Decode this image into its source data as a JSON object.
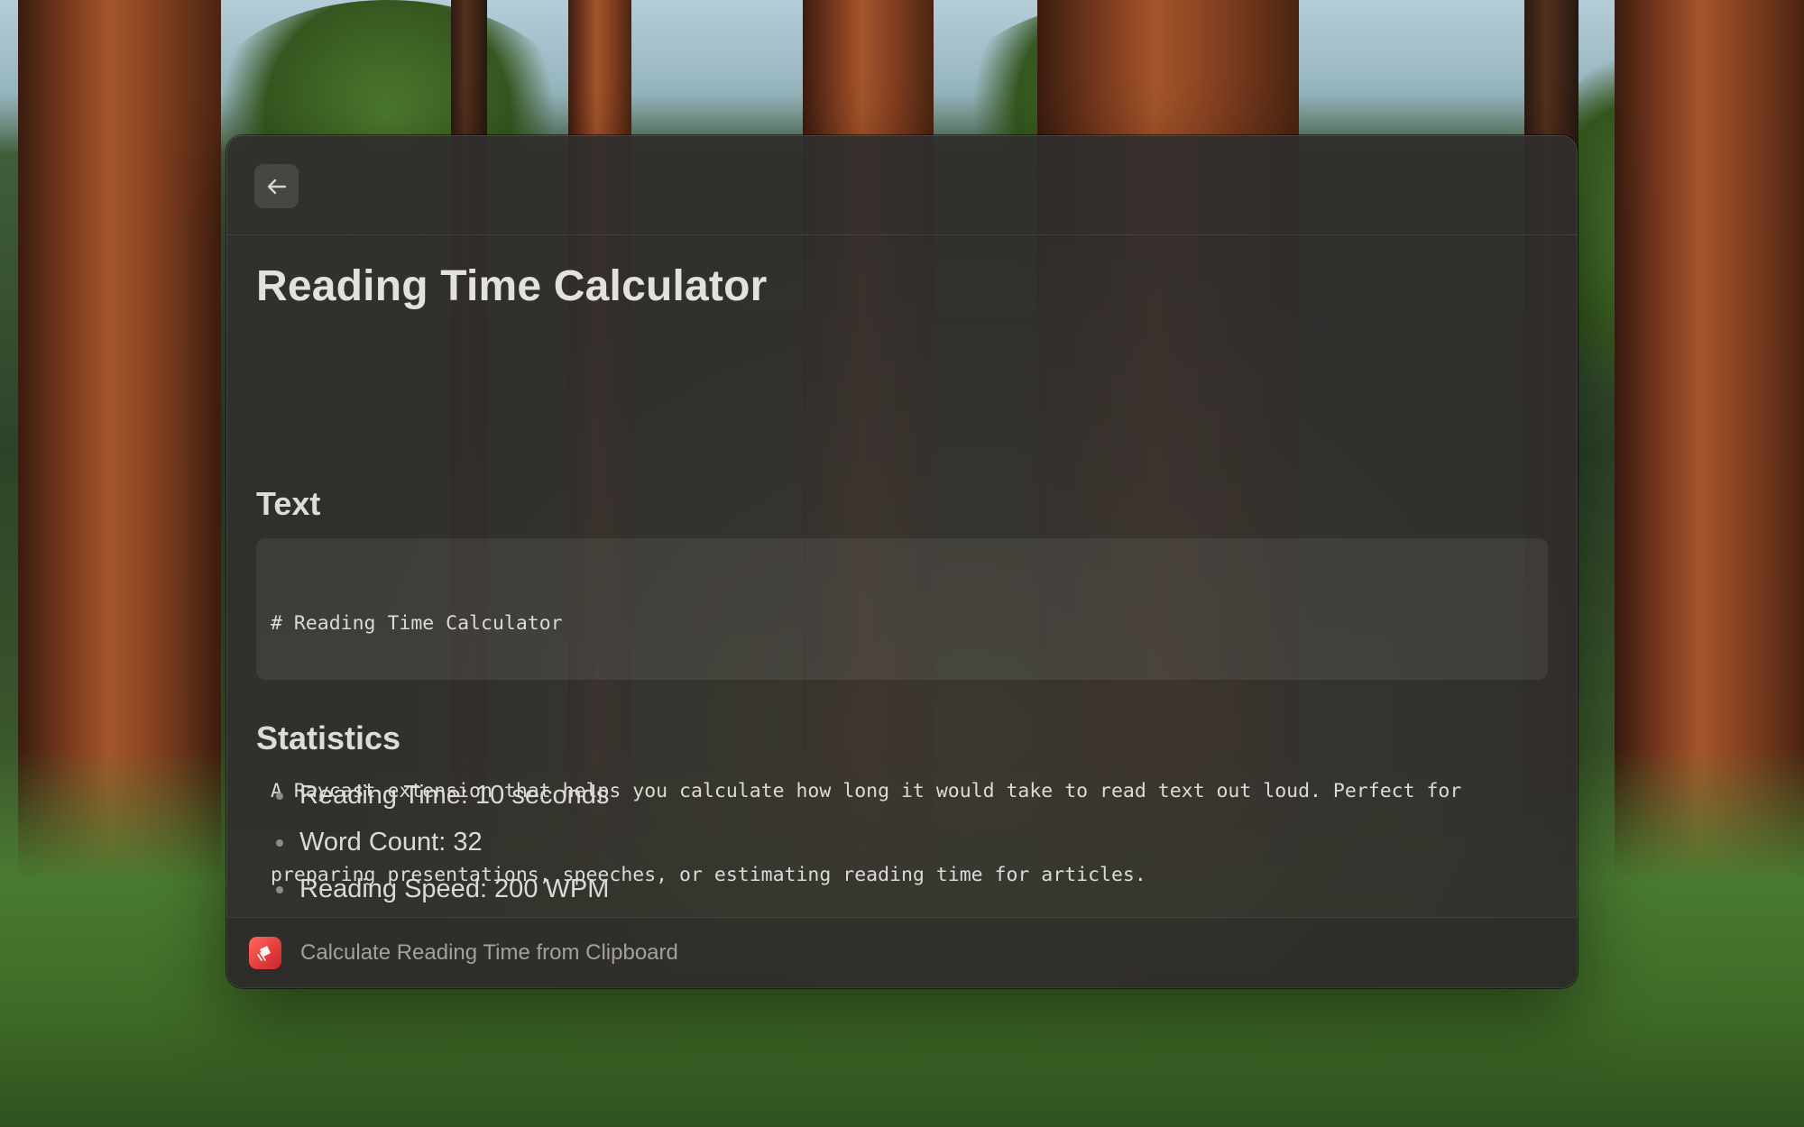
{
  "window": {
    "title": "Reading Time Calculator",
    "back_button_icon": "arrow-left-icon"
  },
  "text_section": {
    "heading": "Text",
    "code_lines": [
      "# Reading Time Calculator",
      "",
      "A Raycast extension that helps you calculate how long it would take to read text out loud. Perfect for",
      "preparing presentations, speeches, or estimating reading time for articles."
    ]
  },
  "statistics_section": {
    "heading": "Statistics",
    "items": [
      "Reading Time: 10 seconds",
      "Word Count: 32",
      "Reading Speed: 200 WPM"
    ]
  },
  "footer": {
    "app_icon": "raycast-extension-icon",
    "label": "Calculate Reading Time from Clipboard"
  },
  "colors": {
    "window_bg": "#302e2d",
    "app_icon_accent": "#e23b3b"
  }
}
